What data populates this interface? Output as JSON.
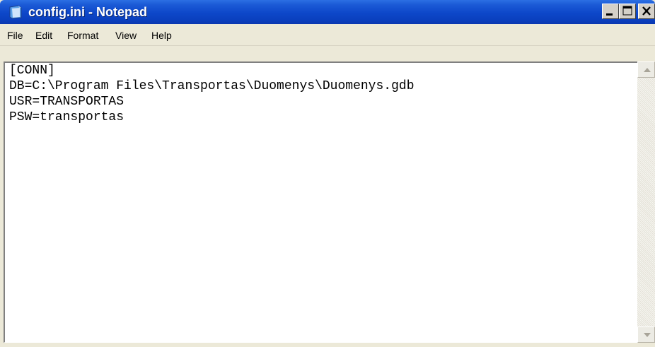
{
  "window": {
    "title": "config.ini - Notepad"
  },
  "title_controls": {
    "minimize_icon": "minimize-icon",
    "maximize_icon": "maximize-icon",
    "close_icon": "close-icon"
  },
  "menu": {
    "items": [
      "File",
      "Edit",
      "Format",
      "View",
      "Help"
    ]
  },
  "editor": {
    "content": "[CONN]\nDB=C:\\Program Files\\Transportas\\Duomenys\\Duomenys.gdb\nUSR=TRANSPORTAS\nPSW=transportas"
  },
  "colors": {
    "titlebar": "#0a47c9",
    "window_face": "#ece9d8",
    "editor_bg": "#ffffff"
  }
}
